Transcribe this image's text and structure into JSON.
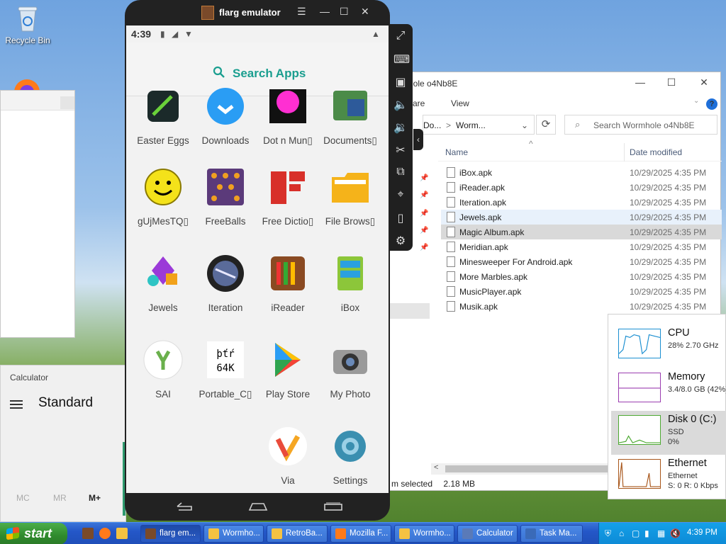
{
  "desktop": {
    "recycle_bin_label": "Recycle Bin"
  },
  "calculator": {
    "title": "Calculator",
    "mode": "Standard",
    "memory_buttons": [
      "MC",
      "MR",
      "M+"
    ]
  },
  "emulator": {
    "title": "flarg emulator",
    "status_time": "4:39",
    "search_label": "Search Apps",
    "apps": [
      {
        "label": "Easter Eggs",
        "icon": "easter-eggs-icon"
      },
      {
        "label": "Downloads",
        "icon": "downloads-icon"
      },
      {
        "label": "Dot n Mun▯",
        "icon": "dot-n-mun-icon"
      },
      {
        "label": "Documents▯",
        "icon": "documents-icon"
      },
      {
        "label": "gUjMesTQ▯",
        "icon": "smiley-icon"
      },
      {
        "label": "FreeBalls",
        "icon": "freeballs-icon"
      },
      {
        "label": "Free Dictio▯",
        "icon": "dictionary-icon"
      },
      {
        "label": "File Brows▯",
        "icon": "folder-icon"
      },
      {
        "label": "Jewels",
        "icon": "jewels-icon"
      },
      {
        "label": "Iteration",
        "icon": "iteration-icon"
      },
      {
        "label": "iReader",
        "icon": "ireader-icon"
      },
      {
        "label": "iBox",
        "icon": "ibox-icon"
      },
      {
        "label": "SAI",
        "icon": "sai-icon"
      },
      {
        "label": "Portable_C▯",
        "icon": "portable-icon"
      },
      {
        "label": "Play Store",
        "icon": "play-store-icon"
      },
      {
        "label": "My Photo",
        "icon": "camera-icon"
      },
      {
        "label": "Via",
        "icon": "via-icon"
      },
      {
        "label": "Settings",
        "icon": "settings-icon"
      }
    ],
    "portable_icon_text": [
      "þťŕ",
      "64K"
    ]
  },
  "explorer": {
    "title": "mhole o4Nb8E",
    "ribbon": [
      "are",
      "View"
    ],
    "address": [
      "Do...",
      ">",
      "Worm..."
    ],
    "search_placeholder": "Search Wormhole o4Nb8E",
    "columns": {
      "name": "Name",
      "date": "Date modified"
    },
    "files": [
      {
        "name": "iBox.apk",
        "date": "10/29/2025 4:35 PM"
      },
      {
        "name": "iReader.apk",
        "date": "10/29/2025 4:35 PM"
      },
      {
        "name": "Iteration.apk",
        "date": "10/29/2025 4:35 PM"
      },
      {
        "name": "Jewels.apk",
        "date": "10/29/2025 4:35 PM"
      },
      {
        "name": "Magic Album.apk",
        "date": "10/29/2025 4:35 PM"
      },
      {
        "name": "Meridian.apk",
        "date": "10/29/2025 4:35 PM"
      },
      {
        "name": "Minesweeper For Android.apk",
        "date": "10/29/2025 4:35 PM"
      },
      {
        "name": "More Marbles.apk",
        "date": "10/29/2025 4:35 PM"
      },
      {
        "name": "MusicPlayer.apk",
        "date": "10/29/2025 4:35 PM"
      },
      {
        "name": "Musik.apk",
        "date": "10/29/2025 4:35 PM"
      }
    ],
    "status_selected": "m selected",
    "status_size": "2.18 MB"
  },
  "task_manager": {
    "items": [
      {
        "title": "CPU",
        "line1": "28%  2.70 GHz",
        "line2": "",
        "color": "#1b8fd1"
      },
      {
        "title": "Memory",
        "line1": "3.4/8.0 GB (42%)",
        "line2": "",
        "color": "#9b3db0"
      },
      {
        "title": "Disk 0 (C:)",
        "line1": "SSD",
        "line2": "0%",
        "color": "#4da932"
      },
      {
        "title": "Ethernet",
        "line1": "Ethernet",
        "line2": "S: 0  R: 0 Kbps",
        "color": "#a8561a"
      }
    ]
  },
  "taskbar": {
    "start_label": "start",
    "buttons": [
      {
        "label": "flarg em..."
      },
      {
        "label": "Wormho..."
      },
      {
        "label": "RetroBa..."
      },
      {
        "label": "Mozilla F..."
      },
      {
        "label": "Wormho..."
      },
      {
        "label": "Calculator"
      },
      {
        "label": "Task Ma..."
      }
    ],
    "clock": "4:39 PM"
  }
}
